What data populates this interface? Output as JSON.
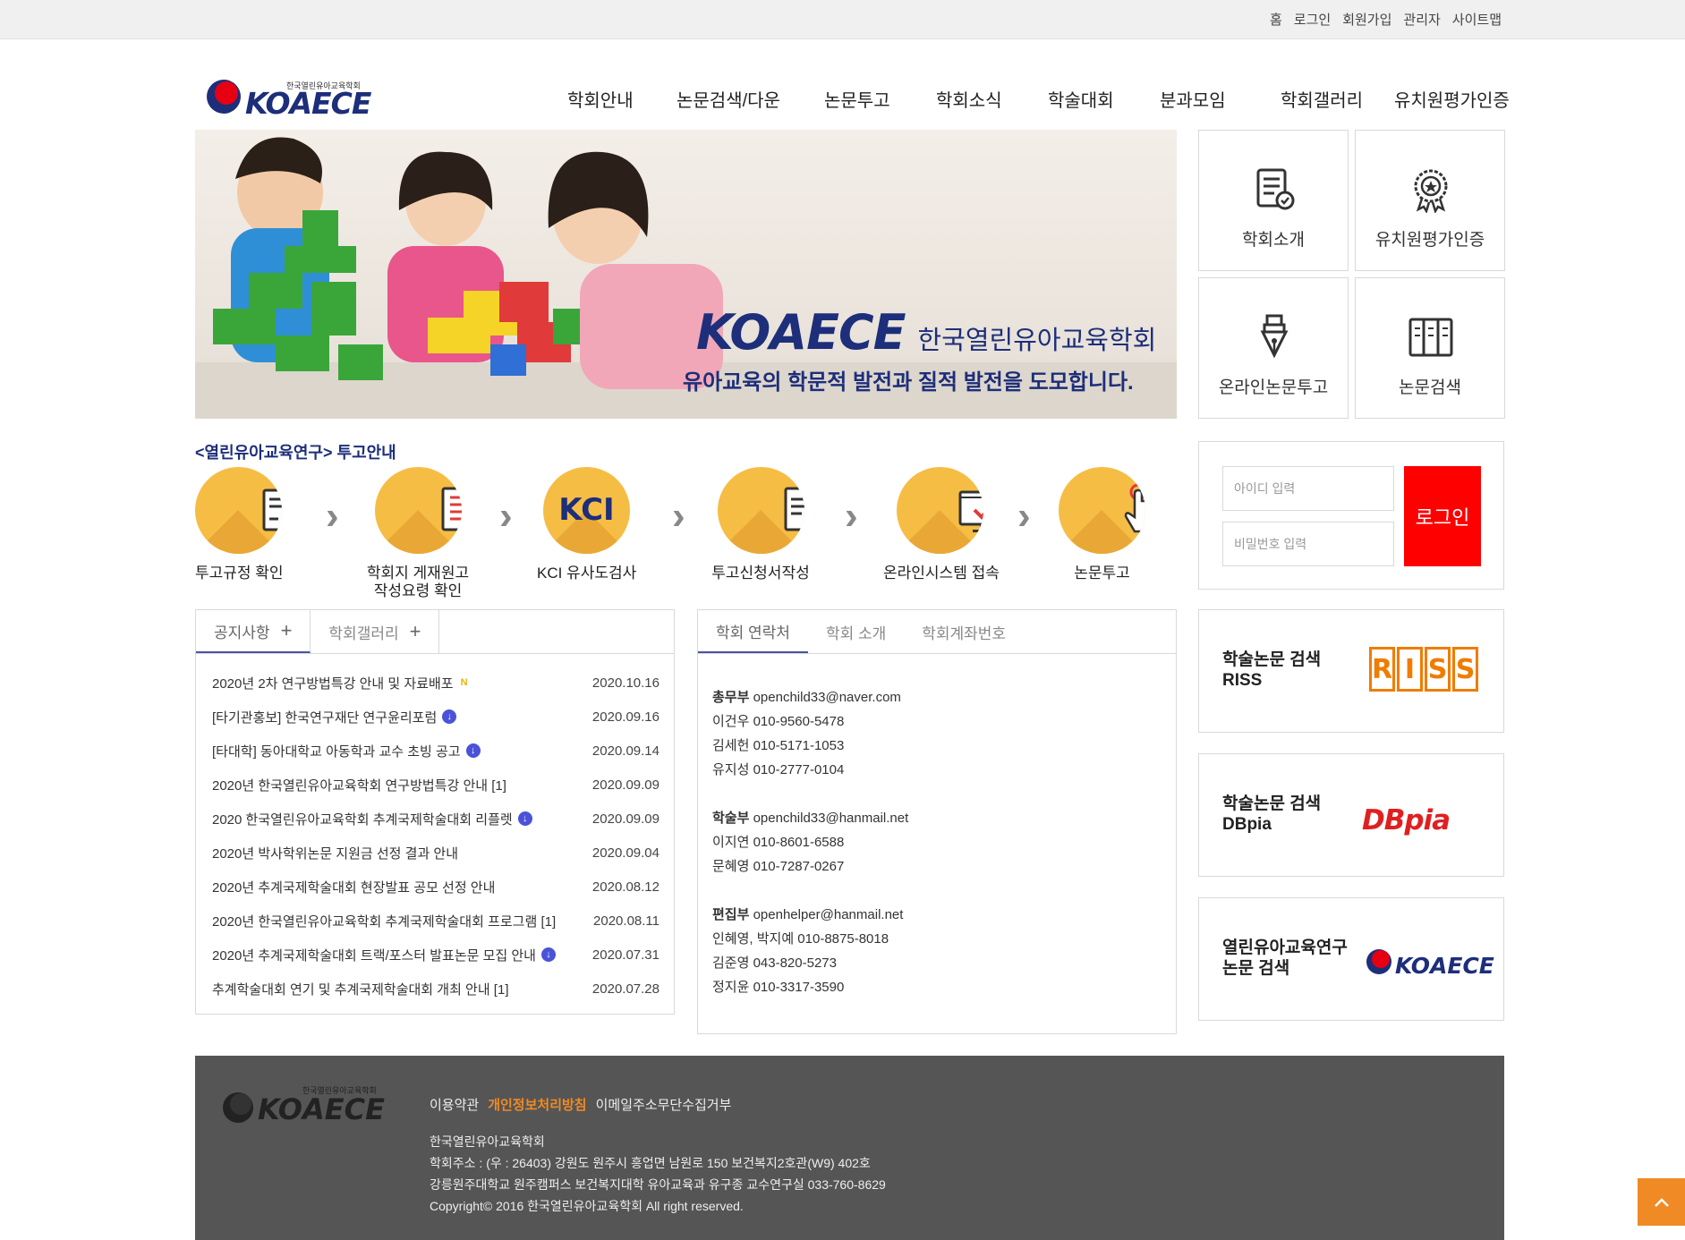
{
  "util_links": [
    "홈",
    "로그인",
    "회원가입",
    "관리자",
    "사이트맵"
  ],
  "logo": {
    "name": "KOAECE",
    "sub": "한국열린유아교육학회"
  },
  "gnb": [
    "학회안내",
    "논문검색/다운",
    "논문투고",
    "학회소식",
    "학술대회",
    "분과모임",
    "학회갤러리",
    "유치원평가인증"
  ],
  "banner": {
    "title_en": "KOAECE",
    "title_ko": "한국열린유아교육학회",
    "subtitle": "유아교육의 학문적 발전과 질적 발전을 도모합니다."
  },
  "quick": [
    {
      "label": "학회소개",
      "icon": "document-check-icon"
    },
    {
      "label": "유치원평가인증",
      "icon": "award-badge-icon"
    },
    {
      "label": "온라인논문투고",
      "icon": "pen-nib-icon"
    },
    {
      "label": "논문검색",
      "icon": "bookshelf-icon"
    }
  ],
  "guide": {
    "title": "<열린유아교육연구> 투고안내",
    "steps": [
      {
        "label": "투고규정 확인",
        "icon": "document-search-icon"
      },
      {
        "label": "학회지 게재원고\n작성요령 확인",
        "icon": "document-list-icon"
      },
      {
        "label": "KCI 유사도검사",
        "icon": "kci-icon",
        "text": "KCI"
      },
      {
        "label": "투고신청서작성",
        "icon": "form-edit-icon"
      },
      {
        "label": "온라인시스템 접속",
        "icon": "monitor-check-icon"
      },
      {
        "label": "논문투고",
        "icon": "hand-click-icon"
      }
    ]
  },
  "login": {
    "id_placeholder": "아이디 입력",
    "pw_placeholder": "비밀번호 입력",
    "button": "로그인"
  },
  "notice": {
    "tabs": [
      "공지사항",
      "학회갤러리"
    ],
    "plus": "+",
    "items": [
      {
        "title": "2020년 2차 연구방법특강 안내 및 자료배포",
        "date": "2020.10.16",
        "new": "N",
        "file": false
      },
      {
        "title": "[타기관홍보] 한국연구재단 연구윤리포럼",
        "date": "2020.09.16",
        "new": "",
        "file": true
      },
      {
        "title": "[타대학] 동아대학교 아동학과 교수 초빙 공고",
        "date": "2020.09.14",
        "new": "",
        "file": true
      },
      {
        "title": "2020년 한국열린유아교육학회 연구방법특강 안내 [1]",
        "date": "2020.09.09",
        "new": "",
        "file": false
      },
      {
        "title": "2020 한국열린유아교육학회 추계국제학술대회 리플렛",
        "date": "2020.09.09",
        "new": "",
        "file": true
      },
      {
        "title": "2020년 박사학위논문 지원금 선정 결과 안내",
        "date": "2020.09.04",
        "new": "",
        "file": false
      },
      {
        "title": "2020년 추계국제학술대회 현장발표 공모 선정 안내",
        "date": "2020.08.12",
        "new": "",
        "file": false
      },
      {
        "title": "2020년 한국열린유아교육학회 추계국제학술대회 프로그램 [1]",
        "date": "2020.08.11",
        "new": "",
        "file": false
      },
      {
        "title": "2020년 추계국제학술대회 트랙/포스터 발표논문 모집 안내",
        "date": "2020.07.31",
        "new": "",
        "file": true
      },
      {
        "title": "추계학술대회 연기 및 추계국제학술대회 개최 안내 [1]",
        "date": "2020.07.28",
        "new": "",
        "file": false
      }
    ]
  },
  "contact": {
    "tabs": [
      "학회 연락처",
      "학회 소개",
      "학회계좌번호"
    ],
    "groups": [
      {
        "dept": "총무부",
        "email": "openchild33@naver.com",
        "people": [
          "이건우 010-9560-5478",
          "김세헌 010-5171-1053",
          "유지성 010-2777-0104"
        ]
      },
      {
        "dept": "학술부",
        "email": "openchild33@hanmail.net",
        "people": [
          "이지연 010-8601-6588",
          "문혜영 010-7287-0267"
        ]
      },
      {
        "dept": "편집부",
        "email": "openhelper@hanmail.net",
        "people": [
          "인혜영, 박지예 010-8875-8018",
          "김준영 043-820-5273",
          "정지윤 010-3317-3590"
        ]
      }
    ]
  },
  "search_links": [
    {
      "label": "학술논문 검색\nRISS",
      "logo": "RISS"
    },
    {
      "label": "학술논문 검색\nDBpia",
      "logo": "DBpia"
    },
    {
      "label": "열린유아교육연구\n논문 검색",
      "logo": "KOAECE"
    }
  ],
  "footer": {
    "links": [
      "이용약관",
      "개인정보처리방침",
      "이메일주소무단수집거부"
    ],
    "info": [
      "한국열린유아교육학회",
      "학회주소 : (우 : 26403) 강원도 원주시 흥업면 남원로 150 보건복지2호관(W9) 402호",
      "강릉원주대학교 원주캠퍼스 보건복지대학 유아교육과 유구종 교수연구실 033-760-8629",
      "Copyright© 2016 한국열린유아교육학회 All right reserved."
    ]
  },
  "colors": {
    "brand_navy": "#1d2e7a",
    "accent_orange": "#f08a24",
    "login_red": "#ff0000",
    "step_yellow": "#f6bd45"
  }
}
